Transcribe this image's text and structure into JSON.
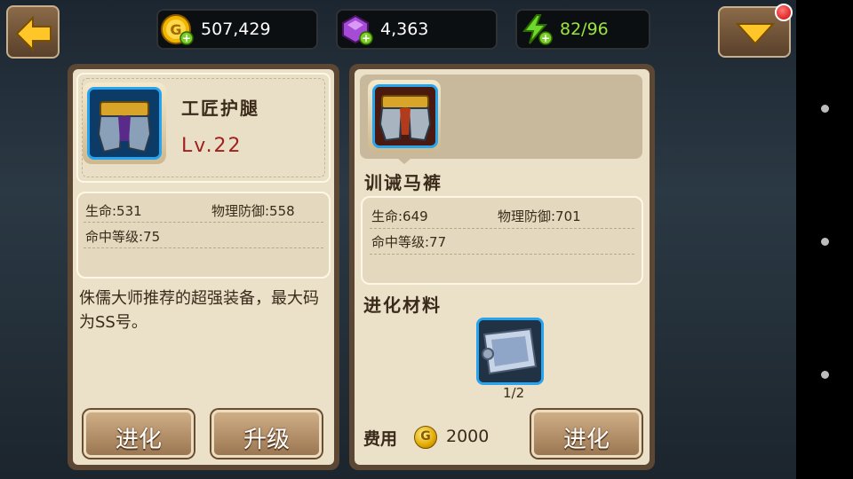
{
  "resources": {
    "gold": "507,429",
    "gems": "4,363",
    "energy": "82/96"
  },
  "left_card": {
    "name": "工匠护腿",
    "level": "Lv.22",
    "stats": {
      "hp": "生命:531",
      "phys_def": "物理防御:558",
      "hit": "命中等级:75"
    },
    "description": "侏儒大师推荐的超强装备，最大码为SS号。",
    "evolve_label": "进化",
    "upgrade_label": "升级"
  },
  "right_card": {
    "name": "训诫马裤",
    "stats": {
      "hp": "生命:649",
      "phys_def": "物理防御:701",
      "hit": "命中等级:77"
    },
    "materials_title": "进化材料",
    "material_count": "1/2",
    "fee_label": "费用",
    "fee_value": "2000",
    "evolve_label": "进化"
  },
  "colors": {
    "panel_border": "#5b4733",
    "panel_bg": "#ebe0c8",
    "level_red": "#a02020",
    "energy_green": "#9be63c",
    "icon_blue": "#26a4ef"
  },
  "icons": [
    "back-arrow-icon",
    "gold-coin-icon",
    "gem-icon",
    "energy-icon",
    "dropdown-arrow-icon",
    "notification-badge"
  ]
}
